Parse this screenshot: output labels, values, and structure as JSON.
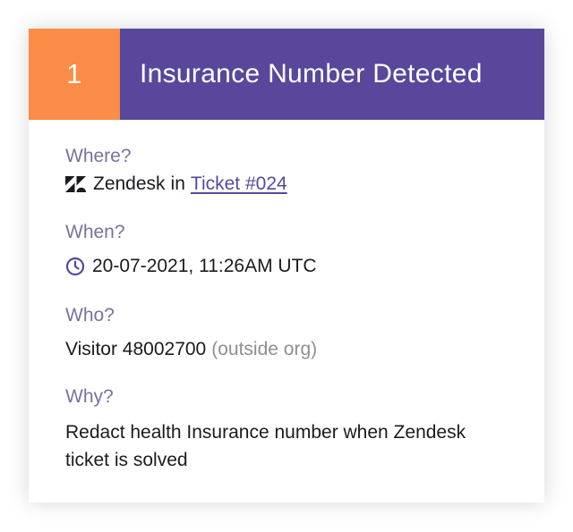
{
  "colors": {
    "badge_bg": "#fa8c47",
    "title_bg": "#58479b",
    "label": "#77739c",
    "link": "#574a9c"
  },
  "header": {
    "number": "1",
    "title": "Insurance Number Detected"
  },
  "where": {
    "label": "Where?",
    "app_icon": "zendesk-icon",
    "app": "Zendesk",
    "connector": "in",
    "link": "Ticket #024"
  },
  "when": {
    "label": "When?",
    "icon": "clock-icon",
    "value": "20-07-2021, 11:26AM UTC"
  },
  "who": {
    "label": "Who?",
    "name": "Visitor 48002700",
    "note": "(outside org)"
  },
  "why": {
    "label": "Why?",
    "text": "Redact health Insurance number when Zendesk ticket is solved"
  }
}
